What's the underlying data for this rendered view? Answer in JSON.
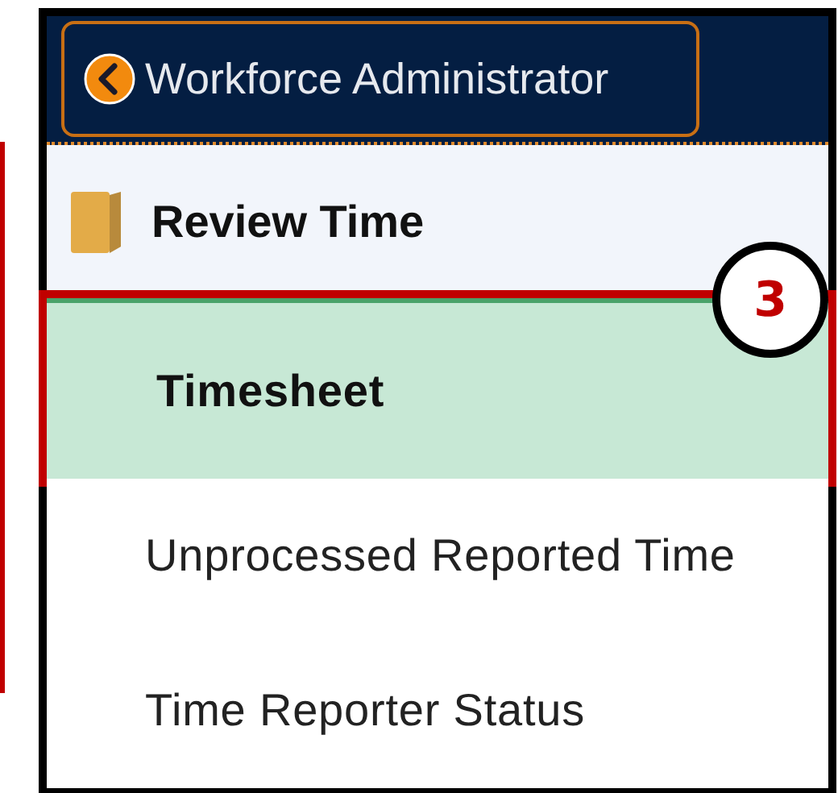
{
  "header": {
    "back_button": {
      "label": "Workforce Administrator"
    }
  },
  "folder": {
    "label": "Review Time"
  },
  "items": [
    {
      "label": "Timesheet",
      "selected": true,
      "callout": "3"
    },
    {
      "label": "Unprocessed Reported Time",
      "selected": false
    },
    {
      "label": "Time Reporter Status",
      "selected": false
    }
  ]
}
